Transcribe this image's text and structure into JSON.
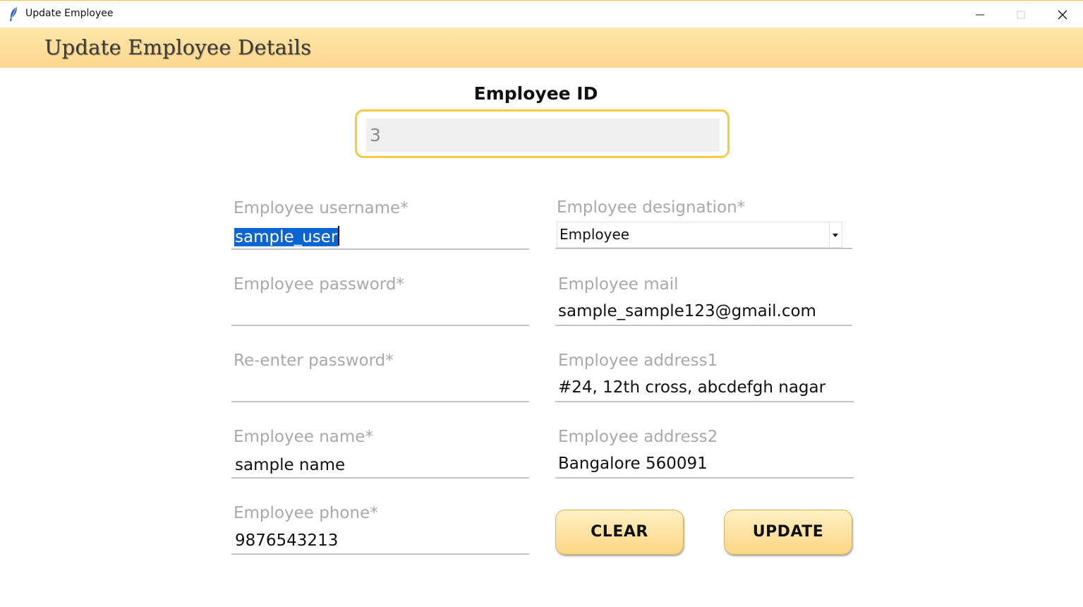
{
  "window": {
    "title": "Update Employee"
  },
  "header": {
    "title": "Update Employee Details"
  },
  "employee_id": {
    "label": "Employee ID",
    "value": "3"
  },
  "fields": {
    "username": {
      "label": "Employee username*",
      "value": "sample_user"
    },
    "password": {
      "label": "Employee password*",
      "value": ""
    },
    "reenter_password": {
      "label": "Re-enter password*",
      "value": ""
    },
    "name": {
      "label": "Employee name*",
      "value": "sample name"
    },
    "phone": {
      "label": "Employee phone*",
      "value": "9876543213"
    },
    "designation": {
      "label": "Employee designation*",
      "value": "Employee"
    },
    "mail": {
      "label": "Employee mail",
      "value": "sample_sample123@gmail.com"
    },
    "address1": {
      "label": "Employee address1",
      "value": "#24, 12th cross, abcdefgh nagar"
    },
    "address2": {
      "label": "Employee address2",
      "value": "Bangalore 560091"
    }
  },
  "buttons": {
    "clear": "CLEAR",
    "update": "UPDATE"
  },
  "colors": {
    "header_band": "#fdd890",
    "accent_border": "#f7c948",
    "selection": "#0a64d2"
  },
  "icons": {
    "app": "feather-icon",
    "minimize": "minimize-icon",
    "maximize": "maximize-icon",
    "close": "close-icon",
    "dropdown": "dropdown-arrow-icon"
  }
}
